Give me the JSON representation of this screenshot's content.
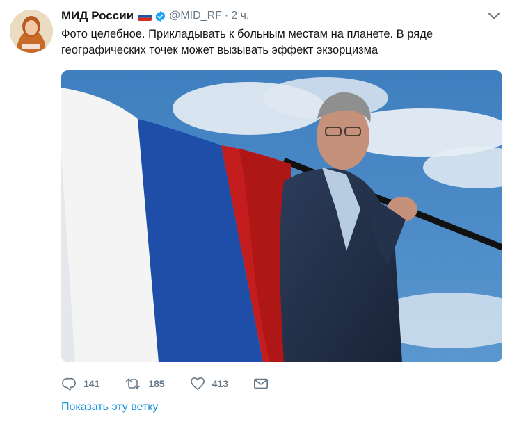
{
  "tweet": {
    "author_name": "МИД России",
    "flag_icon": "russian-flag-icon",
    "verified_icon": "verified-badge-icon",
    "handle": "@MID_RF",
    "separator": "·",
    "time": "2 ч.",
    "menu_icon": "chevron-down-icon",
    "text_line1": "Фото целебное. Прикладывать к больным местам на планете. В ряде",
    "text_line2": "географических точек может вызывать эффект экзорцизма",
    "media_description_icon": "photo-image"
  },
  "actions": {
    "reply_icon": "reply-icon",
    "reply_count": "141",
    "retweet_icon": "retweet-icon",
    "retweet_count": "185",
    "like_icon": "heart-icon",
    "like_count": "413",
    "dm_icon": "envelope-icon"
  },
  "footer": {
    "show_thread": "Показать эту ветку"
  },
  "colors": {
    "link": "#1b95e0",
    "muted": "#657786",
    "text": "#14171a",
    "verified": "#1da1f2"
  }
}
